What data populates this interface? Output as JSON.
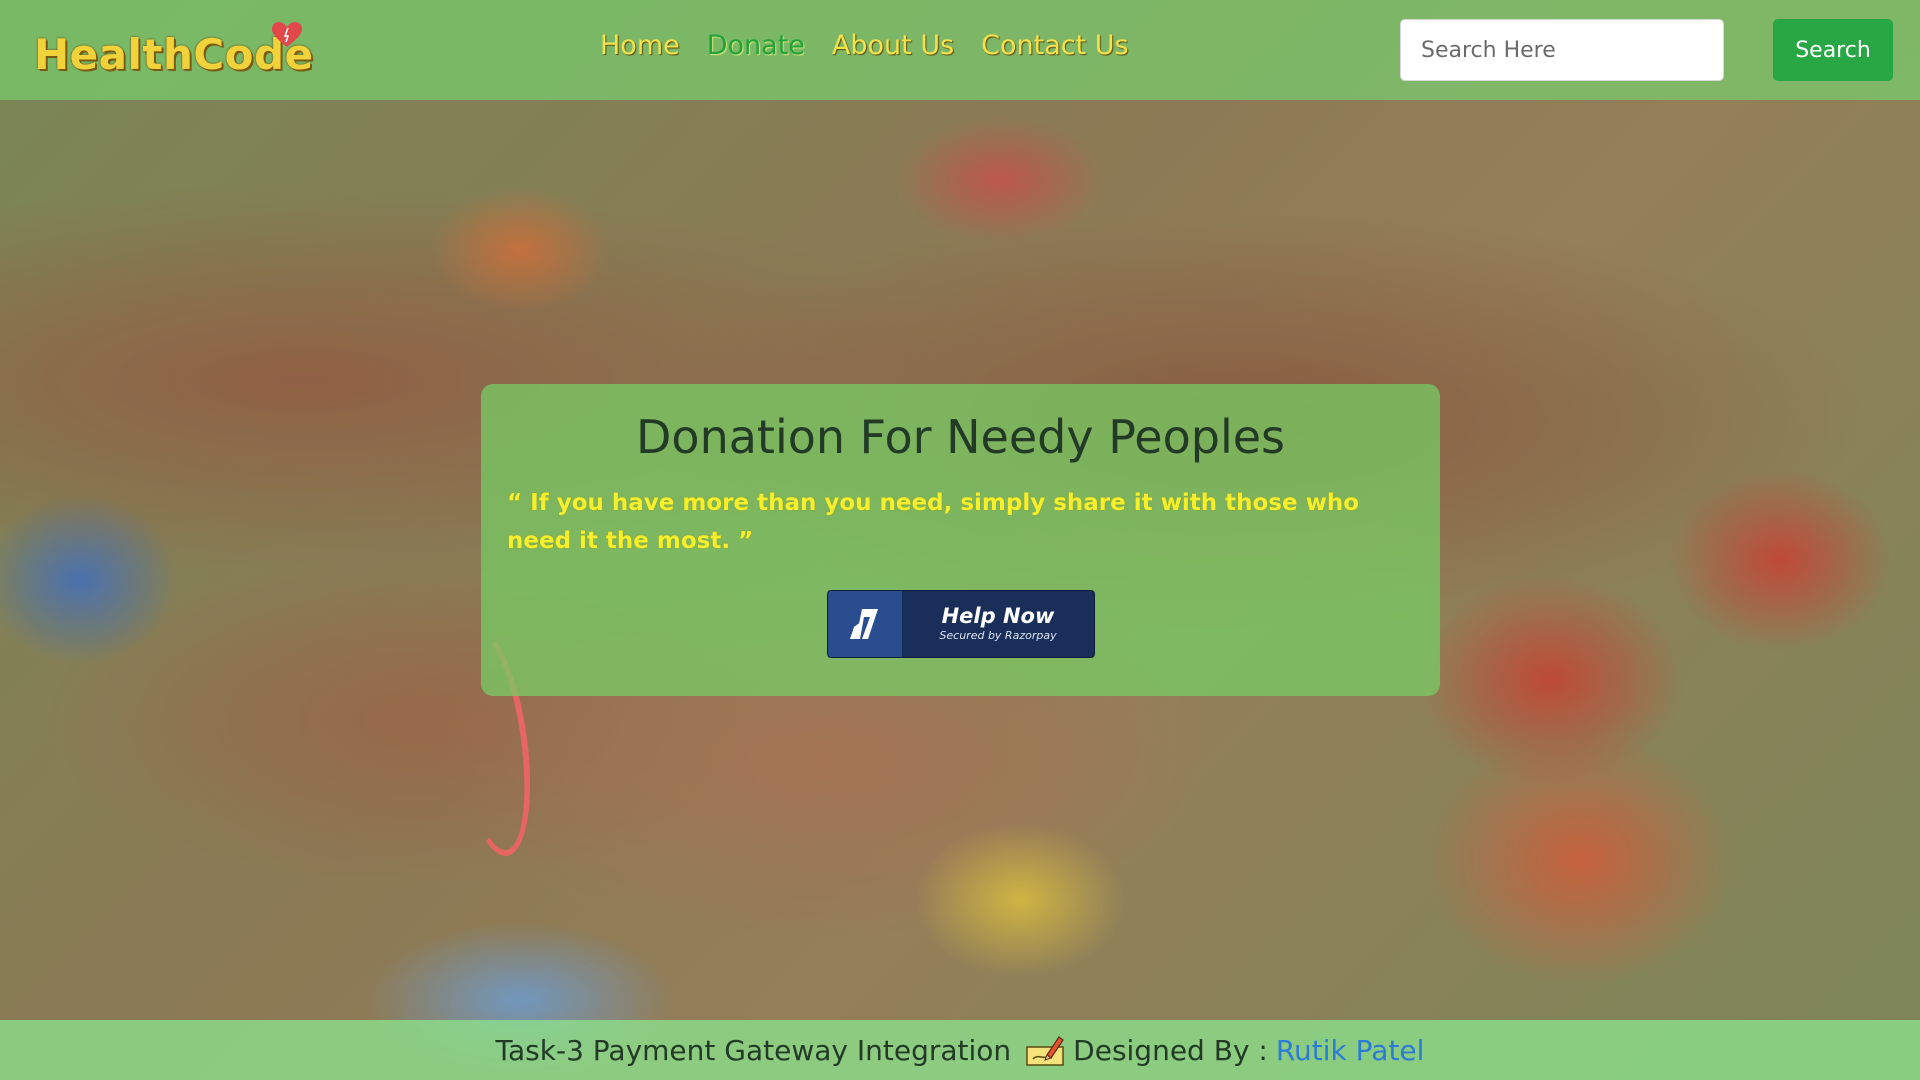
{
  "brand": {
    "name": "HealthCode",
    "logo_icon": "heart-icon",
    "color": "#f2d23b"
  },
  "nav": {
    "items": [
      {
        "label": "Home",
        "active": false
      },
      {
        "label": "Donate",
        "active": true
      },
      {
        "label": "About Us",
        "active": false
      },
      {
        "label": "Contact Us",
        "active": false
      }
    ]
  },
  "search": {
    "placeholder": "Search Here",
    "value": "",
    "button_label": "Search"
  },
  "donation": {
    "title": "Donation For Needy Peoples",
    "quote_open": "“",
    "quote": " If you have more than you need, simply share it with those who need it the most. ",
    "quote_close": "”",
    "button_label": "Help Now",
    "button_subtitle": "Secured by Razorpay",
    "button_icon": "razorpay-icon"
  },
  "footer": {
    "text": "Task-3 Payment Gateway Integration",
    "icon": "pencil-writing-icon",
    "credit_label": "Designed By :",
    "author": "Rutik Patel",
    "author_color": "#2b7bd6"
  },
  "colors": {
    "nav_bar": "#78cd6e",
    "active_link": "#21a33a",
    "link": "#f3e24b",
    "search_button": "#28a745",
    "quote_text": "#f6ef2b",
    "help_button": "#1a2e5a"
  }
}
